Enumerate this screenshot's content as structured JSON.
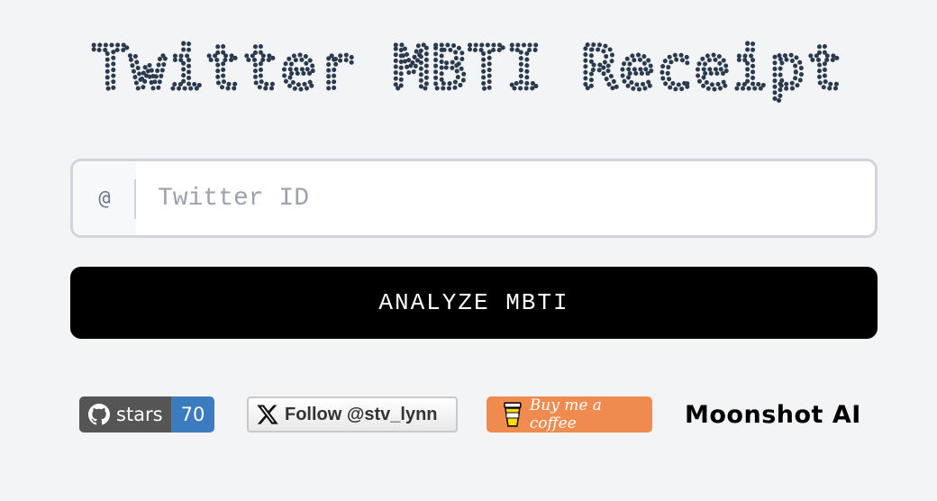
{
  "title": "Twitter MBTI Receipt",
  "input": {
    "prefix": "@",
    "placeholder": "Twitter ID",
    "value": ""
  },
  "analyze_button": {
    "label": "ANALYZE MBTI"
  },
  "badges": {
    "github": {
      "label": "stars",
      "count": "70"
    },
    "x_follow": {
      "label": "Follow @stv_lynn"
    },
    "coffee": {
      "label": "Buy me a coffee"
    },
    "sponsor": {
      "label": "Moonshot AI"
    }
  },
  "colors": {
    "background": "#f3f4f6",
    "title": "#2b3a4e",
    "button": "#000000",
    "github_count": "#3b7bbf",
    "coffee": "#ef8b4f"
  }
}
